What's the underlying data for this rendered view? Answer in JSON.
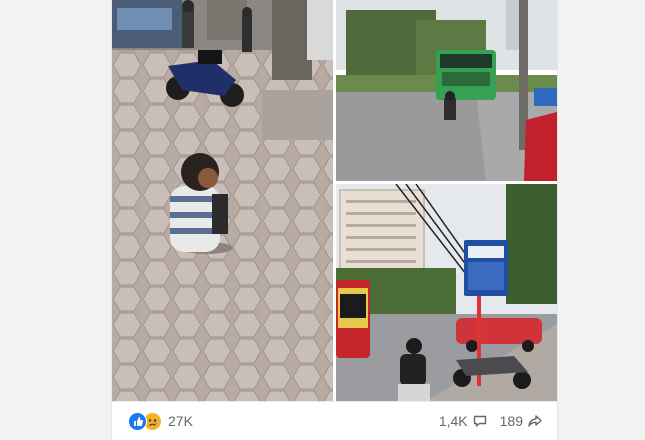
{
  "post": {
    "photos": [
      {
        "name": "photo-man-sitting-on-sidewalk"
      },
      {
        "name": "photo-street-with-green-bus"
      },
      {
        "name": "photo-bus-stop-sign-street"
      }
    ],
    "reactions": {
      "icons": [
        "like-icon",
        "sad-icon"
      ],
      "count": "27K"
    },
    "comments": {
      "count": "1,4K",
      "icon": "comment-icon"
    },
    "shares": {
      "count": "189",
      "icon": "share-icon"
    },
    "colors": {
      "like": "#1877f2",
      "sad": "#f7b125",
      "text": "#65676b"
    }
  }
}
